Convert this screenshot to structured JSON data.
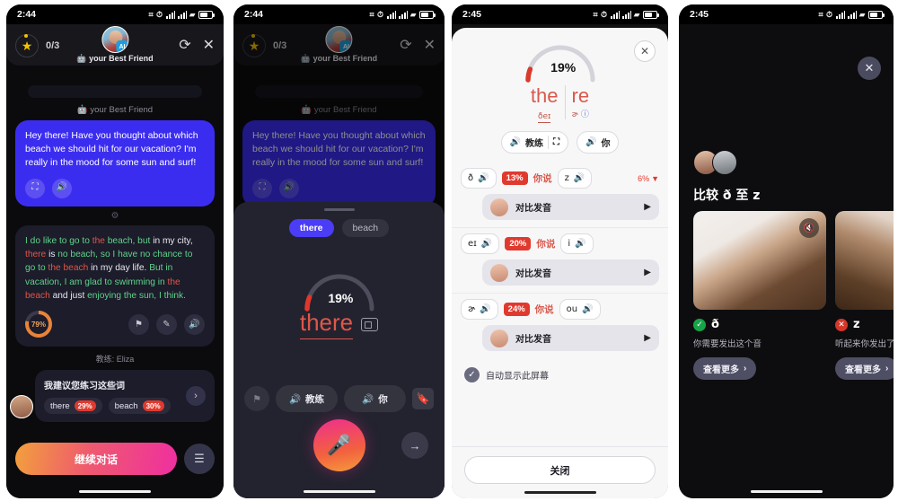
{
  "panel1": {
    "status": {
      "time": "2:44"
    },
    "header": {
      "counter": "0/3",
      "ai_badge": "AI",
      "title": "🤖 your Best Friend",
      "refresh_icon": "refresh-icon",
      "close_icon": "close-icon"
    },
    "bot_label": "🤖 your Best Friend",
    "bot_message": "Hey there! Have you thought about which beach we should hit for our vacation? I'm really in the mood for some sun and surf!",
    "user_message": "I do like to go to the beach, but in my city, there is no beach, so I have no chance to go to the beach in my day life. But in vacation, I am glad to swimming in the beach and just enjoying the sun, I think.",
    "user_score": "79%",
    "coach_label": "教练: Eliza",
    "suggestion_title": "我建议您练习这些词",
    "suggestion_chips": [
      {
        "word": "there",
        "pct": "29%"
      },
      {
        "word": "beach",
        "pct": "30%"
      }
    ],
    "cta_label": "继续对话"
  },
  "panel2": {
    "status": {
      "time": "2:44"
    },
    "header": {
      "counter": "0/3",
      "ai_badge": "AI",
      "title": "🤖 your Best Friend"
    },
    "bot_label": "🤖 your Best Friend",
    "bot_message": "Hey there! Have you thought about which beach we should hit for our vacation? I'm really in the mood for some sun and surf!",
    "word_tabs": [
      {
        "label": "there",
        "active": true
      },
      {
        "label": "beach",
        "active": false
      }
    ],
    "score": "19%",
    "score_value": 19,
    "practice_word": "there",
    "buttons": {
      "flag": "flag-icon",
      "coach": "教练",
      "you": "你",
      "bookmark": "bookmark-icon",
      "mic": "mic-icon",
      "next": "→"
    }
  },
  "panel3": {
    "status": {
      "time": "2:45"
    },
    "score": "19%",
    "score_value": 19,
    "syllables": [
      {
        "text": "the",
        "ipa": "ðeɪ",
        "underlined": true
      },
      {
        "text": "re",
        "ipa": "ɚ",
        "info": true
      }
    ],
    "buttons": {
      "coach": "教练",
      "you": "你",
      "keyboard": "keyboard-icon"
    },
    "close_icon": "close-icon",
    "phonemes": [
      {
        "target": "ð",
        "pct": "13%",
        "said_label": "你说",
        "actual": "z",
        "delta": "6%",
        "compare_label": "对比发音"
      },
      {
        "target": "eɪ",
        "pct": "20%",
        "said_label": "你说",
        "actual": "i",
        "delta": "",
        "compare_label": "对比发音"
      },
      {
        "target": "ɚ",
        "pct": "24%",
        "said_label": "你说",
        "actual": "ou",
        "delta": "",
        "compare_label": "对比发音"
      }
    ],
    "auto_show_label": "自动显示此屏幕",
    "close_button": "关闭"
  },
  "panel4": {
    "status": {
      "time": "2:45"
    },
    "close_icon": "close-icon",
    "title": "比较 ð 至 z",
    "cards": [
      {
        "status": "ok",
        "phoneme": "ð",
        "desc": "你需要发出这个音",
        "more_label": "查看更多",
        "mute_icon": "mute-icon"
      },
      {
        "status": "bad",
        "phoneme": "z",
        "desc": "听起来你发出了这个音",
        "more_label": "查看更多"
      }
    ]
  }
}
